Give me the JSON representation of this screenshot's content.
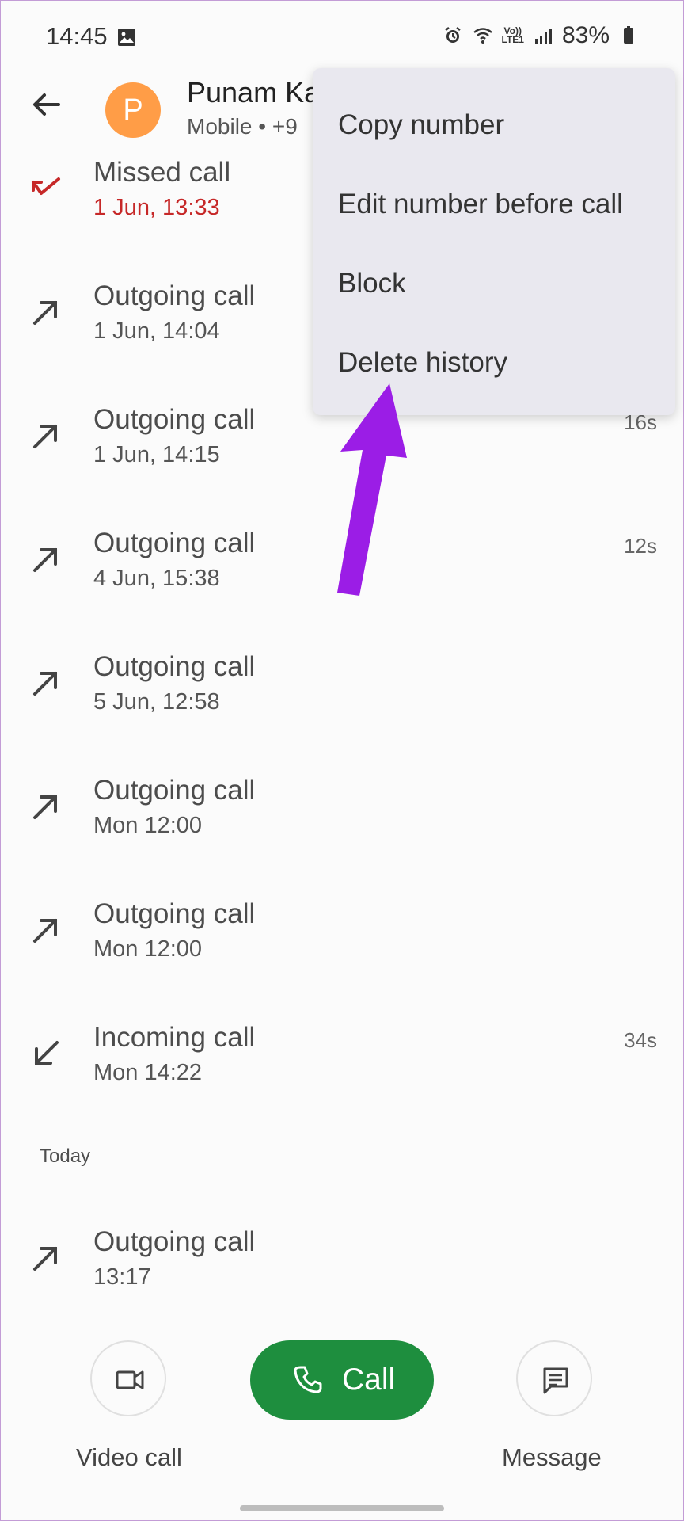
{
  "status_bar": {
    "time": "14:45",
    "battery": "83%",
    "network_label": "Vo))\nLTE1"
  },
  "header": {
    "avatar_letter": "P",
    "name": "Punam Ka",
    "subtitle": "Mobile • +9"
  },
  "menu": {
    "items": [
      "Copy number",
      "Edit number before call",
      "Block",
      "Delete history"
    ]
  },
  "calls": [
    {
      "type": "missed",
      "title": "Missed call",
      "time": "1 Jun, 13:33",
      "duration": ""
    },
    {
      "type": "outgoing",
      "title": "Outgoing call",
      "time": "1 Jun, 14:04",
      "duration": ""
    },
    {
      "type": "outgoing",
      "title": "Outgoing call",
      "time": "1 Jun, 14:15",
      "duration": "16s"
    },
    {
      "type": "outgoing",
      "title": "Outgoing call",
      "time": "4 Jun, 15:38",
      "duration": "12s"
    },
    {
      "type": "outgoing",
      "title": "Outgoing call",
      "time": "5 Jun, 12:58",
      "duration": ""
    },
    {
      "type": "outgoing",
      "title": "Outgoing call",
      "time": "Mon 12:00",
      "duration": ""
    },
    {
      "type": "outgoing",
      "title": "Outgoing call",
      "time": "Mon 12:00",
      "duration": ""
    },
    {
      "type": "incoming",
      "title": "Incoming call",
      "time": "Mon 14:22",
      "duration": "34s"
    },
    {
      "type": "outgoing",
      "title": "Outgoing call",
      "time": "13:17",
      "duration": ""
    }
  ],
  "section": {
    "today": "Today"
  },
  "actions": {
    "video_label": "Video call",
    "call_label": "Call",
    "message_label": "Message"
  },
  "colors": {
    "avatar": "#ff9d47",
    "missed": "#c62828",
    "call_button": "#1e8e3e",
    "annotation_arrow": "#9b1de6",
    "menu_background": "#e9e8ef"
  },
  "icons": {
    "back": "back-arrow-icon",
    "missed": "missed-call-icon",
    "outgoing": "outgoing-call-icon",
    "incoming": "incoming-call-icon",
    "video": "video-camera-icon",
    "call": "phone-icon",
    "message": "message-icon"
  }
}
